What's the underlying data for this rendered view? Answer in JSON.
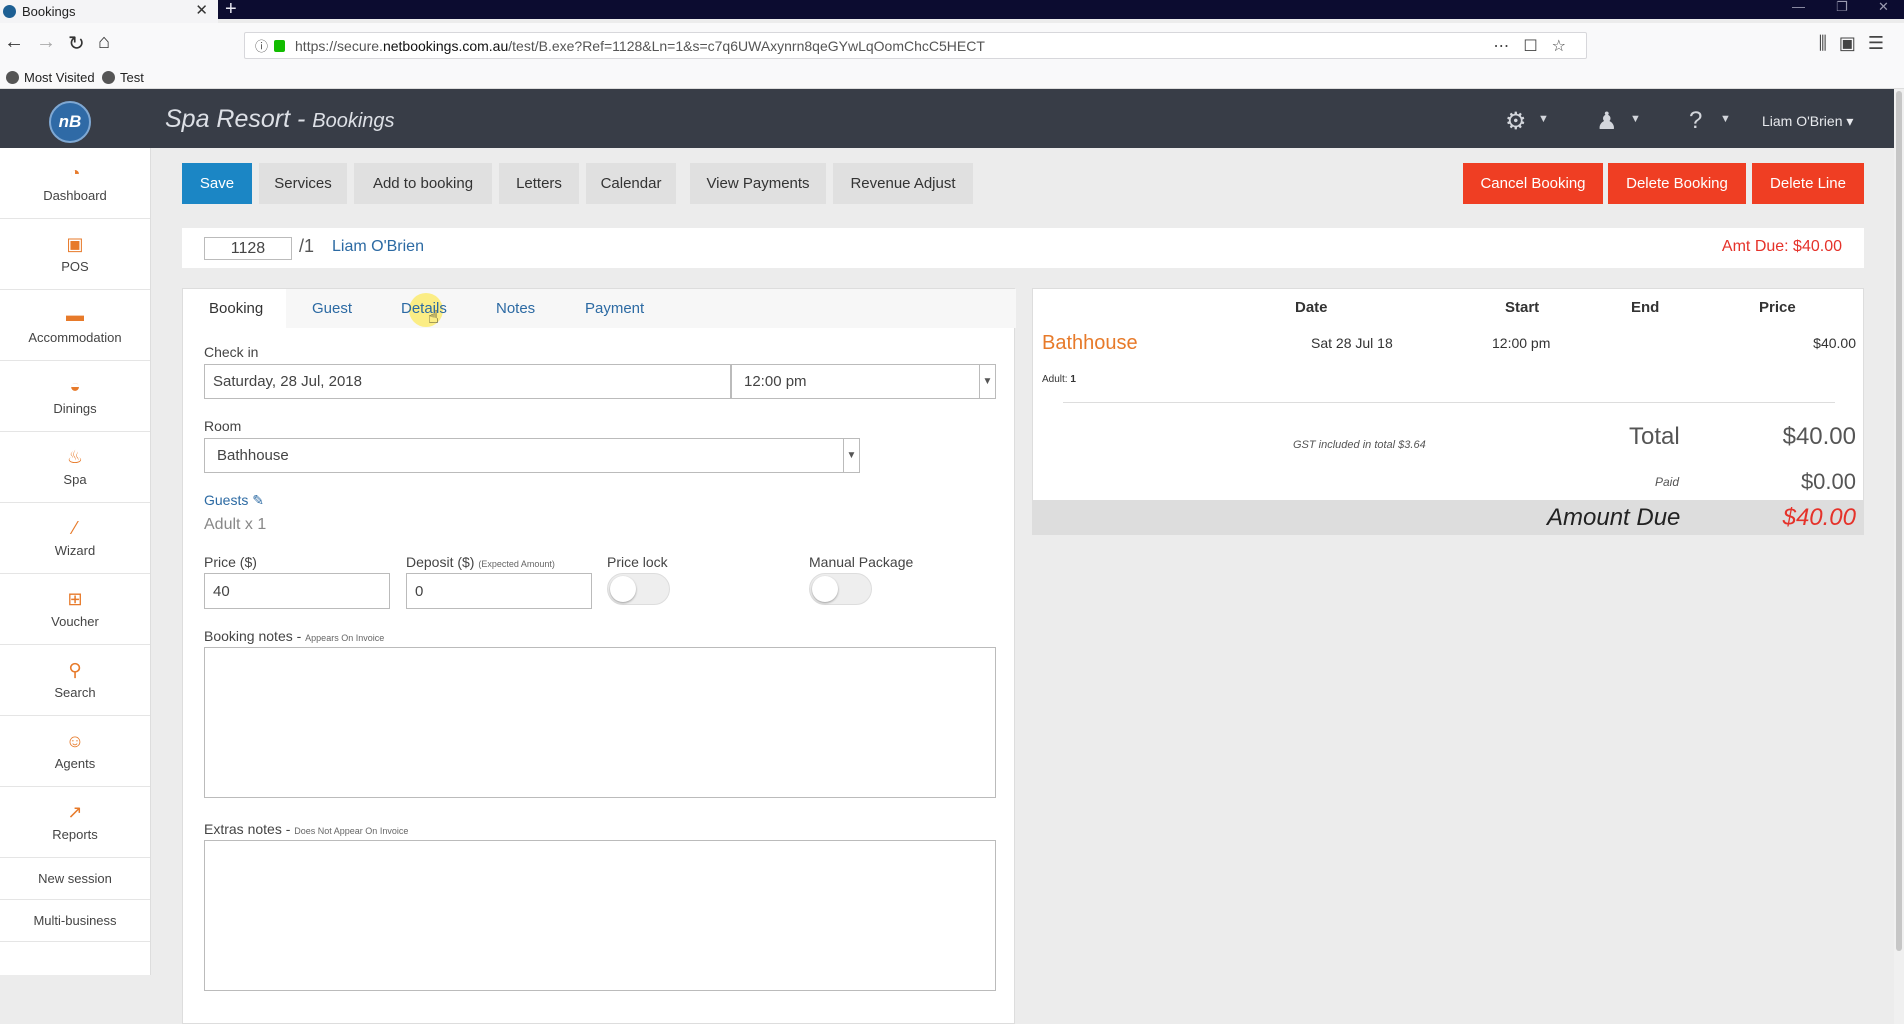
{
  "browser": {
    "tab_title": "Bookings",
    "tab_close": "✕",
    "new_tab": "+",
    "url_host_prefix": "https://secure.",
    "url_host": "netbookings.com.au",
    "url_path": "/test/B.exe?Ref=1128&Ln=1&s=c7q6UWAxynrn8qeGYwLqOomChcC5HECT",
    "bookmarks": [
      "Most Visited",
      "Test"
    ]
  },
  "header": {
    "logo": "nB",
    "app_name": "Spa Resort - ",
    "section": "Bookings",
    "user": "Liam O'Brien"
  },
  "sidebar": {
    "items": [
      "Dashboard",
      "POS",
      "Accommodation",
      "Dinings",
      "Spa",
      "Wizard",
      "Voucher",
      "Search",
      "Agents",
      "Reports"
    ],
    "links": [
      "New session",
      "Multi-business"
    ]
  },
  "toolbar": {
    "save": "Save",
    "services": "Services",
    "add_to_booking": "Add to booking",
    "letters": "Letters",
    "calendar": "Calendar",
    "view_payments": "View Payments",
    "revenue_adjust": "Revenue Adjust",
    "cancel_booking": "Cancel Booking",
    "delete_booking": "Delete Booking",
    "delete_line": "Delete Line"
  },
  "booking": {
    "ref": "1128",
    "line": "/1",
    "guest_name": "Liam O'Brien",
    "amt_due": "Amt Due: $40.00"
  },
  "tabs": [
    "Booking",
    "Guest",
    "Details",
    "Notes",
    "Payment"
  ],
  "form": {
    "checkin_label": "Check in",
    "checkin_date": "Saturday, 28 Jul, 2018",
    "checkin_time": "12:00 pm",
    "room_label": "Room",
    "room_value": "Bathhouse",
    "guests_label": "Guests",
    "guests_value": "Adult x 1",
    "price_label": "Price ($)",
    "price_value": "40",
    "deposit_label": "Deposit ($)",
    "deposit_note": "(Expected Amount)",
    "deposit_value": "0",
    "price_lock_label": "Price lock",
    "manual_package_label": "Manual Package",
    "booking_notes_label": "Booking notes - ",
    "booking_notes_note": "Appears On Invoice",
    "extras_notes_label": "Extras notes - ",
    "extras_notes_note": "Does Not Appear On Invoice"
  },
  "summary": {
    "col_date": "Date",
    "col_start": "Start",
    "col_end": "End",
    "col_price": "Price",
    "item": "Bathhouse",
    "date": "Sat 28 Jul 18",
    "start": "12:00 pm",
    "end": "",
    "price": "$40.00",
    "adult_label": "Adult: ",
    "adult_count": "1",
    "gst_note": "GST included in total $3.64",
    "total_label": "Total",
    "total_value": "$40.00",
    "paid_label": "Paid",
    "paid_value": "$0.00",
    "amount_due_label": "Amount Due",
    "amount_due_value": "$40.00"
  }
}
